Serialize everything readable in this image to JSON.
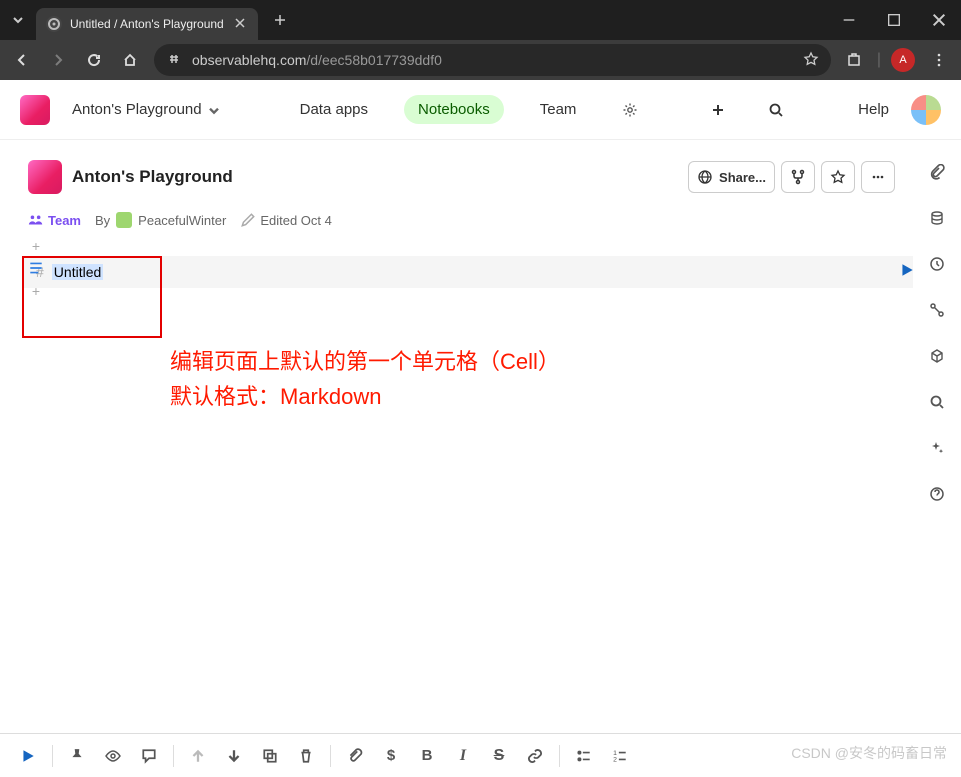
{
  "browser": {
    "tab_title": "Untitled / Anton's Playground",
    "url_host": "observablehq.com",
    "url_path": "/d/eec58b017739ddf0",
    "avatar_letter": "A"
  },
  "header": {
    "workspace": "Anton's Playground",
    "nav": {
      "data_apps": "Data apps",
      "notebooks": "Notebooks",
      "team": "Team"
    },
    "help": "Help"
  },
  "notebook": {
    "title": "Anton's Playground",
    "share": "Share...",
    "meta": {
      "team": "Team",
      "by": "By",
      "author": "PeacefulWinter",
      "edited": "Edited Oct 4"
    },
    "cell": {
      "hash": "#",
      "text": "Untitled"
    }
  },
  "annotation": {
    "line1": "编辑页面上默认的第一个单元格（Cell）",
    "line2": "默认格式：Markdown"
  },
  "watermark": "CSDN @安冬的码畜日常"
}
